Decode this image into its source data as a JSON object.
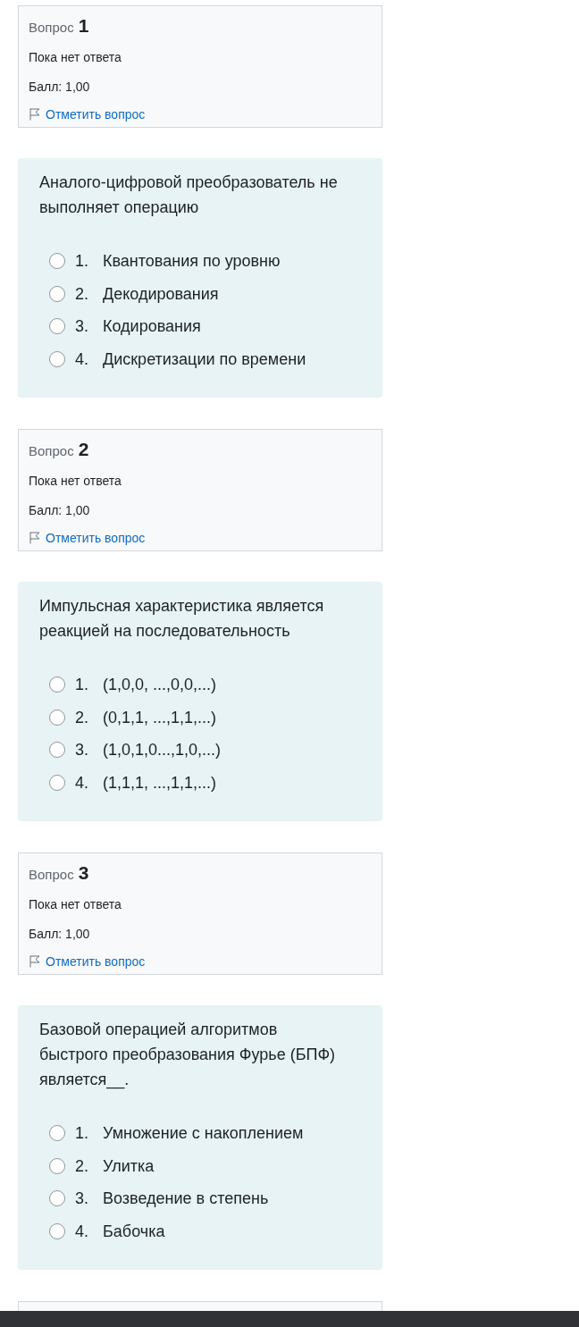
{
  "questions": [
    {
      "info": {
        "label": "Вопрос",
        "number": "1",
        "status": "Пока нет ответа",
        "grade": "Балл: 1,00",
        "flag_link": "Отметить вопрос"
      },
      "text": "Аналого-цифровой преобразователь не выполняет операцию",
      "options": [
        {
          "number": "1.",
          "label": "Квантования по уровню",
          "selected": false
        },
        {
          "number": "2.",
          "label": "Декодирования",
          "selected": false
        },
        {
          "number": "3.",
          "label": "Кодирования",
          "selected": false
        },
        {
          "number": "4.",
          "label": "Дискретизации по времени",
          "selected": false
        }
      ]
    },
    {
      "info": {
        "label": "Вопрос",
        "number": "2",
        "status": "Пока нет ответа",
        "grade": "Балл: 1,00",
        "flag_link": "Отметить вопрос"
      },
      "text": "Импульсная характеристика является реакцией на последовательность",
      "options": [
        {
          "number": "1.",
          "label": "(1,0,0, ...,0,0,...)",
          "selected": false
        },
        {
          "number": "2.",
          "label": "(0,1,1, ...,1,1,...)",
          "selected": false
        },
        {
          "number": "3.",
          "label": "(1,0,1,0...,1,0,...)",
          "selected": false
        },
        {
          "number": "4.",
          "label": "(1,1,1, ...,1,1,...)",
          "selected": false
        }
      ]
    },
    {
      "info": {
        "label": "Вопрос",
        "number": "3",
        "status": "Пока нет ответа",
        "grade": "Балл: 1,00",
        "flag_link": "Отметить вопрос"
      },
      "text": "Базовой операцией алгоритмов быстрого преобразования Фурье (БПФ) является__.",
      "options": [
        {
          "number": "1.",
          "label": "Умножение с накоплением",
          "selected": false
        },
        {
          "number": "2.",
          "label": "Улитка",
          "selected": false
        },
        {
          "number": "3.",
          "label": "Возведение в степень",
          "selected": false
        },
        {
          "number": "4.",
          "label": "Бабочка",
          "selected": false
        }
      ]
    }
  ]
}
